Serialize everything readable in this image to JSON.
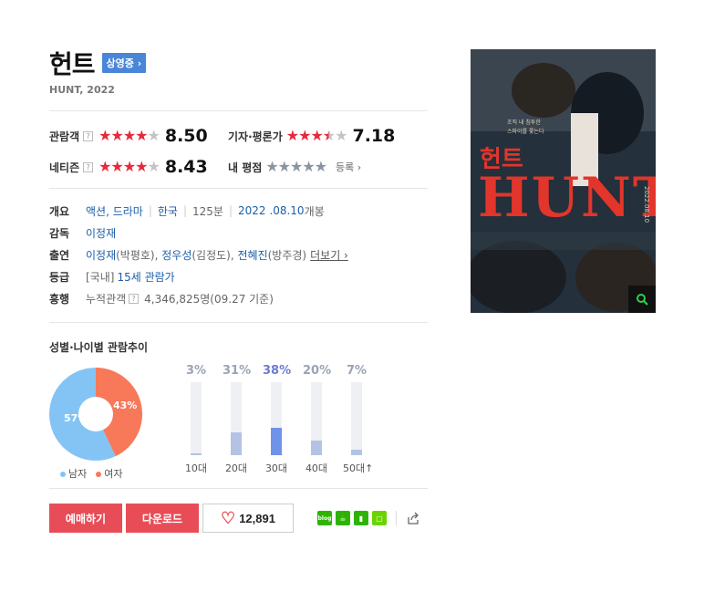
{
  "movie": {
    "title": "헌트",
    "status_badge": "상영중 ›",
    "subtitle": "HUNT, 2022"
  },
  "ratings": {
    "audience": {
      "label": "관람객",
      "help": "?",
      "score": "8.50",
      "stars": "★★★★",
      "stars_off": "★"
    },
    "critics": {
      "label": "기자·평론가",
      "score": "7.18",
      "stars": "★★★",
      "stars_half": "★",
      "stars_off": "★"
    },
    "netizen": {
      "label": "네티즌",
      "help": "?",
      "score": "8.43",
      "stars": "★★★★",
      "stars_off": "★"
    },
    "mine": {
      "label": "내 평점",
      "stars": "★★★★★",
      "register": "등록 ›"
    }
  },
  "info": {
    "overview": {
      "key": "개요",
      "genre": "액션, 드라마",
      "country": "한국",
      "runtime": "125분",
      "release_date": "2022 .08.10",
      "release_suffix": "개봉"
    },
    "director": {
      "key": "감독",
      "name": "이정재"
    },
    "cast": {
      "key": "출연",
      "actor1": "이정재",
      "role1": "(박평호), ",
      "actor2": "정우성",
      "role2": "(김정도), ",
      "actor3": "전혜진",
      "role3": "(방주경)",
      "more": "더보기 ›"
    },
    "grade": {
      "key": "등급",
      "prefix": "[국내]",
      "value": "15세 관람가"
    },
    "boxoffice": {
      "key": "흥행",
      "label": "누적관객",
      "help": "?",
      "value": "4,346,825명",
      "date": "(09.27 기준)"
    }
  },
  "stats": {
    "title": "성별·나이별 관람추이",
    "gender": {
      "male_pct": 57,
      "female_pct": 43,
      "male_label": "57%",
      "female_label": "43%",
      "male_legend": "남자",
      "female_legend": "여자",
      "male_color": "#84c4f5",
      "female_color": "#f7795a"
    },
    "age": [
      {
        "label": "10대",
        "pct": 3,
        "pct_label": "3%"
      },
      {
        "label": "20대",
        "pct": 31,
        "pct_label": "31%"
      },
      {
        "label": "30대",
        "pct": 38,
        "pct_label": "38%",
        "highlight": true
      },
      {
        "label": "40대",
        "pct": 20,
        "pct_label": "20%"
      },
      {
        "label": "50대↑",
        "pct": 7,
        "pct_label": "7%"
      }
    ]
  },
  "actions": {
    "reserve": "예매하기",
    "download": "다운로드",
    "like_count": "12,891",
    "shares": [
      "blog-icon",
      "cafe-icon",
      "bookmark-icon",
      "memo-icon",
      "share-icon"
    ]
  },
  "poster": {
    "title_kr": "헌트",
    "title_en": "HUNT",
    "tagline": "조직 내 침투한\n스파이를 쫓는다",
    "date": "2022.08.10"
  }
}
